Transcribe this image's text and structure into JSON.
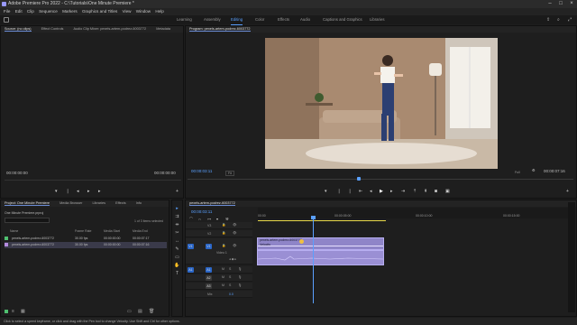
{
  "app": {
    "title": "Adobe Premiere Pro 2022 - C:\\Tutorials\\One Minute Premiere *"
  },
  "menu": [
    "File",
    "Edit",
    "Clip",
    "Sequence",
    "Markers",
    "Graphics and Titles",
    "View",
    "Window",
    "Help"
  ],
  "workspaces": [
    {
      "label": "Learning",
      "active": false
    },
    {
      "label": "Assembly",
      "active": false
    },
    {
      "label": "Editing",
      "active": true
    },
    {
      "label": "Color",
      "active": false
    },
    {
      "label": "Effects",
      "active": false
    },
    {
      "label": "Audio",
      "active": false
    },
    {
      "label": "Captions and Graphics",
      "active": false
    },
    {
      "label": "Libraries",
      "active": false
    }
  ],
  "source_panel": {
    "tabs": [
      "Source: (no clips)",
      "Effect Controls",
      "Audio Clip Mixer: pexels-artem-podrez-6003772",
      "Metadata"
    ],
    "tc_left": "00:00:00:00",
    "tc_right": "00:00:00:00"
  },
  "program_panel": {
    "title": "Program: pexels-artem-podrez-6003772",
    "tc_left": "00:00:03:11",
    "fit": "Fit",
    "quality": "Full",
    "tc_right": "00:00:07:16"
  },
  "project_panel": {
    "tabs": [
      "Project: One Minute Premiere",
      "Media Browser",
      "Libraries",
      "Effects",
      "Info"
    ],
    "path": "One Minute Premiere.prproj",
    "selection": "1 of 3 items selected",
    "columns": [
      "Name",
      "Frame Rate",
      "Media Start",
      "Media End"
    ],
    "rows": [
      {
        "color": "#4fc070",
        "name": "pexels-artem-podrez-6003772",
        "fps": "30.00 fps",
        "start": "00:00:00:00",
        "end": "00:00:07:17"
      },
      {
        "color": "#b58ce0",
        "name": "pexels-artem-podrez-6003772",
        "fps": "30.00 fps",
        "start": "00:00:00:00",
        "end": "00:00:07:16"
      }
    ]
  },
  "timeline": {
    "tab": "pexels-artem-podrez-6003772",
    "tc": "00:00:03:11",
    "ruler": [
      "00:00",
      "00:00:05:00",
      "00:00:10:00",
      "00:00:15:00"
    ],
    "video_tracks": [
      "V3",
      "V2",
      "V1"
    ],
    "audio_tracks": [
      "A1",
      "A2",
      "A3"
    ],
    "mix": "Mix",
    "mix_val": "0.0",
    "clip_label": "pexels-artem-podrez-6003772",
    "clip_sub": "Velocity",
    "v1_label": "Video 1"
  },
  "statusbar": "Click to select a speed keyframe, or click and drag with the Pen tool to change Velocity. Use Shift and Ctrl for other options."
}
